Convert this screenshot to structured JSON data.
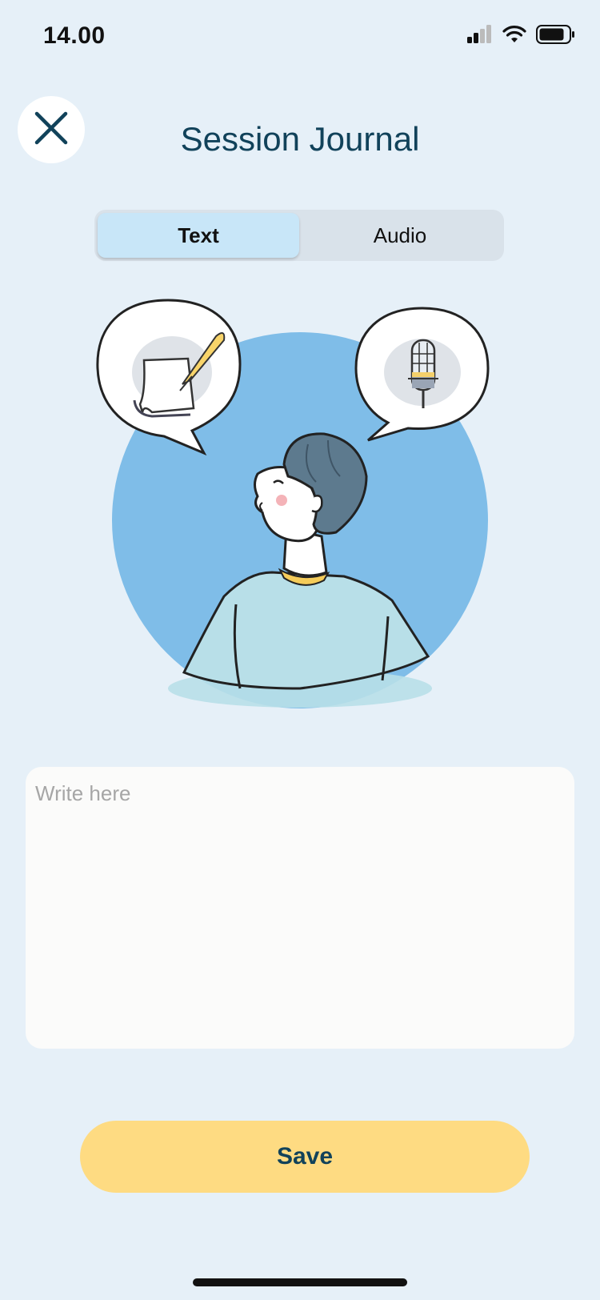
{
  "status_bar": {
    "time": "14.00",
    "icons": [
      "cellular-signal-icon",
      "wifi-icon",
      "battery-icon"
    ]
  },
  "header": {
    "close_icon": "close-icon",
    "title": "Session Journal"
  },
  "tabs": [
    {
      "label": "Text",
      "active": true
    },
    {
      "label": "Audio",
      "active": false
    }
  ],
  "illustration": {
    "icons": [
      "person-illustration",
      "paper-quill-icon",
      "microphone-icon"
    ]
  },
  "journal_input": {
    "value": "",
    "placeholder": "Write here"
  },
  "actions": {
    "save_label": "Save"
  },
  "colors": {
    "background": "#e6f0f8",
    "title": "#11425a",
    "active_tab": "#c8e6f8",
    "tab_track": "#d9e2ea",
    "save_button": "#fedb82",
    "circle": "#7fbde8",
    "input_bg": "#fbfbfa"
  }
}
